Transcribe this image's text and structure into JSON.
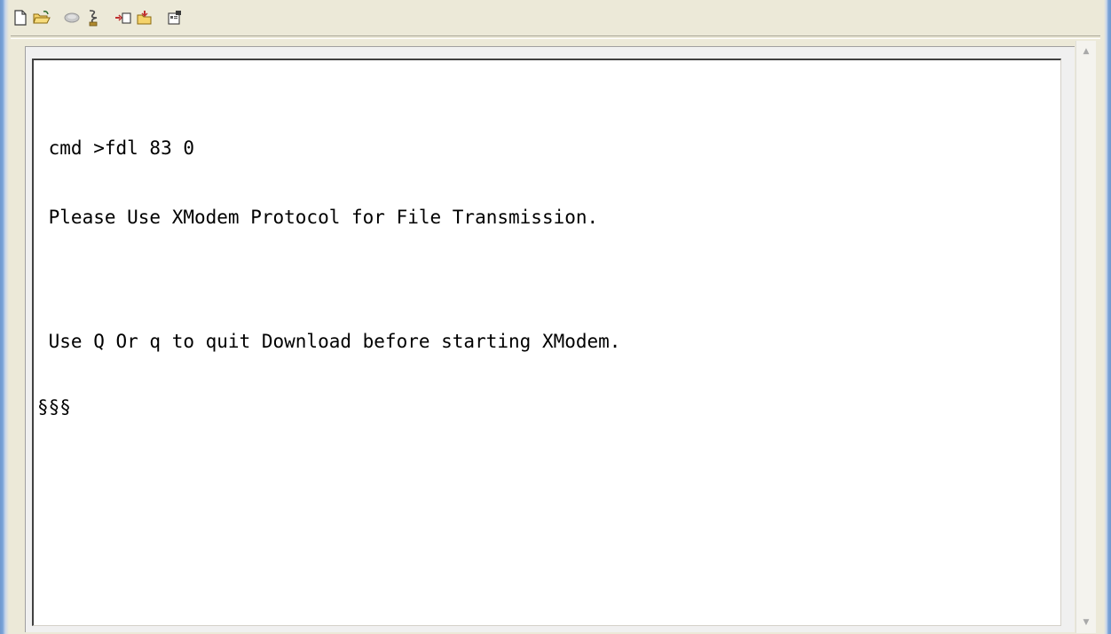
{
  "toolbar": {
    "buttons": [
      {
        "icon": "new-document-icon"
      },
      {
        "icon": "open-folder-icon"
      },
      {
        "icon": "disconnect-icon"
      },
      {
        "icon": "connect-icon"
      },
      {
        "icon": "send-file-icon"
      },
      {
        "icon": "receive-file-icon"
      },
      {
        "icon": "properties-icon"
      }
    ]
  },
  "terminal": {
    "lines": [
      " cmd >fdl 83 0",
      " Please Use XModem Protocol for File Transmission.",
      "",
      " Use Q Or q to quit Download before starting XModem.",
      "§§§"
    ]
  },
  "scrollbar": {
    "up_arrow": "▲",
    "down_arrow": "▼"
  },
  "colors": {
    "frame_blue": "#7aa4d8",
    "window_bg": "#ece9d8",
    "terminal_bg": "#ffffff",
    "terminal_text": "#000000"
  }
}
